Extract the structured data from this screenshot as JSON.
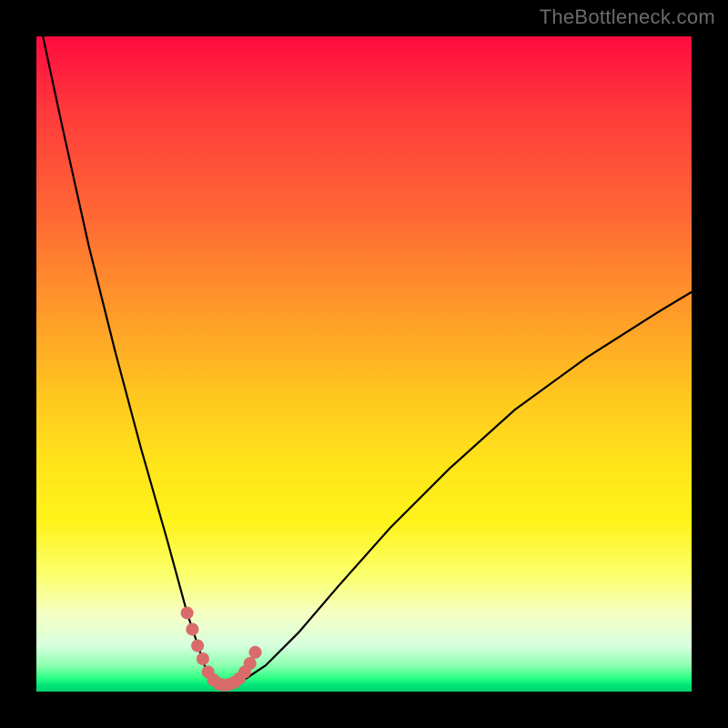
{
  "watermark": "TheBottleneck.com",
  "chart_data": {
    "type": "line",
    "title": "",
    "xlabel": "",
    "ylabel": "",
    "xlim": [
      0,
      100
    ],
    "ylim": [
      0,
      100
    ],
    "grid": false,
    "legend": false,
    "background_gradient": {
      "orientation": "vertical",
      "stops": [
        {
          "pos": 0.0,
          "color": "#ff0b3f"
        },
        {
          "pos": 0.12,
          "color": "#ff3b3b"
        },
        {
          "pos": 0.28,
          "color": "#ff6a34"
        },
        {
          "pos": 0.42,
          "color": "#ff9a2a"
        },
        {
          "pos": 0.55,
          "color": "#ffc71f"
        },
        {
          "pos": 0.65,
          "color": "#ffe31a"
        },
        {
          "pos": 0.74,
          "color": "#fff31a"
        },
        {
          "pos": 0.82,
          "color": "#fbff6a"
        },
        {
          "pos": 0.88,
          "color": "#f6ffc2"
        },
        {
          "pos": 0.93,
          "color": "#d6ffde"
        },
        {
          "pos": 0.96,
          "color": "#8dffb0"
        },
        {
          "pos": 0.98,
          "color": "#2aff82"
        },
        {
          "pos": 0.99,
          "color": "#00e57a"
        },
        {
          "pos": 1.0,
          "color": "#00d26f"
        }
      ]
    },
    "series": [
      {
        "name": "bottleneck-curve",
        "color": "#000000",
        "stroke_width": 2.2,
        "x": [
          1,
          4,
          8,
          12,
          16,
          20,
          23,
          25,
          26,
          27,
          28,
          29,
          30,
          32,
          35,
          40,
          46,
          54,
          63,
          73,
          84,
          95,
          100
        ],
        "y": [
          100,
          86,
          68,
          52,
          37,
          23,
          12,
          6,
          3,
          1.5,
          1,
          1,
          1.2,
          2,
          4,
          9,
          16,
          25,
          34,
          43,
          51,
          58,
          61
        ]
      },
      {
        "name": "valley-marker",
        "type": "scatter",
        "color": "#d96b6b",
        "marker_radius": 7,
        "x": [
          23.0,
          23.8,
          24.6,
          25.4,
          26.2,
          27.0,
          27.8,
          28.6,
          29.4,
          30.2,
          31.0,
          31.8,
          32.6,
          33.4
        ],
        "y": [
          12.0,
          9.5,
          7.0,
          5.0,
          3.0,
          1.8,
          1.2,
          1.0,
          1.1,
          1.4,
          2.0,
          3.0,
          4.3,
          6.0
        ]
      }
    ],
    "valley": {
      "x": 28,
      "y": 1
    }
  }
}
